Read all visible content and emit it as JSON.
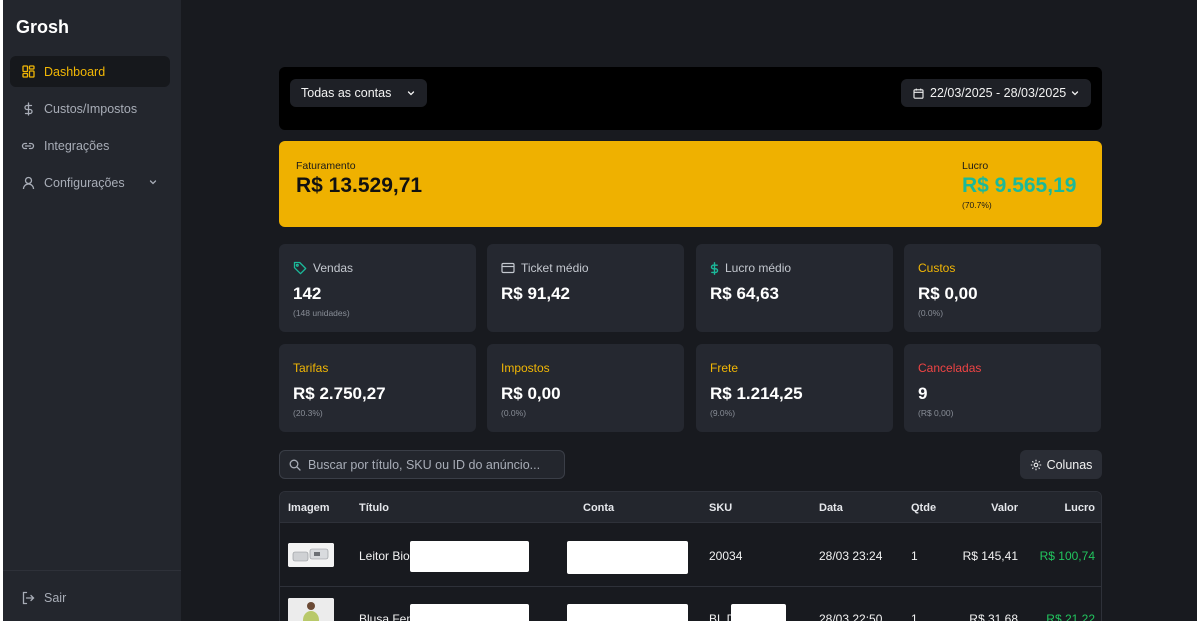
{
  "brand": "Grosh",
  "sidebar": {
    "items": [
      {
        "label": "Dashboard",
        "icon": "grid-icon"
      },
      {
        "label": "Custos/Impostos",
        "icon": "dollar-icon"
      },
      {
        "label": "Integrações",
        "icon": "link-icon"
      },
      {
        "label": "Configurações",
        "icon": "user-icon"
      }
    ],
    "logout": "Sair"
  },
  "topbar": {
    "account_select": "Todas as contas",
    "date_range": "22/03/2025 - 28/03/2025"
  },
  "summary": {
    "revenue_label": "Faturamento",
    "revenue_value": "R$ 13.529,71",
    "profit_label": "Lucro",
    "profit_value": "R$ 9.565,19",
    "profit_pct": "(70.7%)"
  },
  "cards": [
    {
      "label": "Vendas",
      "value": "142",
      "sub": "(148 unidades)"
    },
    {
      "label": "Ticket médio",
      "value": "R$ 91,42",
      "sub": ""
    },
    {
      "label": "Lucro médio",
      "value": "R$ 64,63",
      "sub": ""
    },
    {
      "label": "Custos",
      "value": "R$ 0,00",
      "sub": "(0.0%)"
    },
    {
      "label": "Tarifas",
      "value": "R$ 2.750,27",
      "sub": "(20.3%)"
    },
    {
      "label": "Impostos",
      "value": "R$ 0,00",
      "sub": "(0.0%)"
    },
    {
      "label": "Frete",
      "value": "R$ 1.214,25",
      "sub": "(9.0%)"
    },
    {
      "label": "Canceladas",
      "value": "9",
      "sub": "(R$ 0,00)"
    }
  ],
  "search": {
    "placeholder": "Buscar por título, SKU ou ID do anúncio..."
  },
  "columns_button": "Colunas",
  "table": {
    "headers": [
      "Imagem",
      "Título",
      "Conta",
      "SKU",
      "Data",
      "Qtde",
      "Valor",
      "Lucro"
    ],
    "rows": [
      {
        "title": "Leitor Bior",
        "sku": "20034",
        "date": "28/03 23:24",
        "qty": "1",
        "value": "R$ 145,41",
        "profit": "R$ 100,74"
      },
      {
        "title": "Blusa Fem",
        "sku": "BL D",
        "date": "28/03 22:50",
        "qty": "1",
        "value": "R$ 31,68",
        "profit": "R$ 21,22"
      }
    ]
  },
  "colors": {
    "accent": "#efb100",
    "profit_green": "#1bb99a",
    "canceled_red": "#ef4444"
  }
}
